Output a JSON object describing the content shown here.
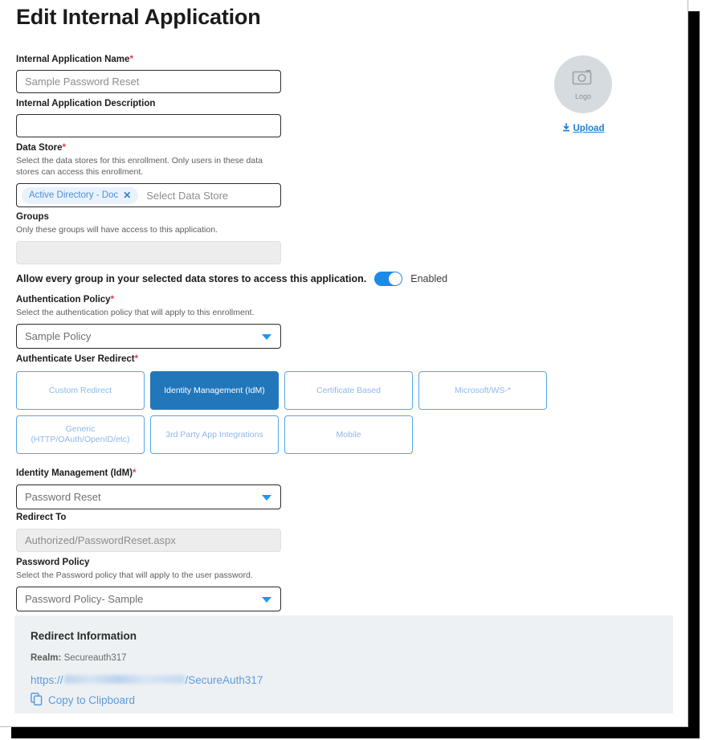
{
  "page": {
    "title": "Edit Internal Application"
  },
  "logo": {
    "placeholder_text": "Logo",
    "camera_icon": "camera-icon",
    "upload_label": "Upload",
    "upload_icon": "download-arrow-icon"
  },
  "fields": {
    "app_name": {
      "label": "Internal Application Name",
      "required_mark": "*",
      "value": "Sample Password Reset",
      "placeholder": "Sample Password Reset"
    },
    "app_description": {
      "label": "Internal Application Description",
      "value": "",
      "placeholder": ""
    },
    "data_store": {
      "label": "Data Store",
      "required_mark": "*",
      "helper": "Select the data stores for this enrollment. Only users in these data stores can access this enrollment.",
      "chips": [
        {
          "label": "Active Directory - Doc",
          "remove_icon": "✕"
        }
      ],
      "placeholder": "Select Data Store"
    },
    "groups": {
      "label": "Groups",
      "helper": "Only these groups will have access to this application.",
      "value": "",
      "disabled": true
    },
    "allow_all_groups": {
      "label": "Allow every group in your selected data stores to access this application.",
      "state_label": "Enabled",
      "enabled": true
    },
    "auth_policy": {
      "label": "Authentication Policy",
      "required_mark": "*",
      "helper": "Select the authentication policy that will apply to this enrollment.",
      "value": "Sample Policy"
    },
    "authenticate_user_redirect": {
      "label": "Authenticate User Redirect",
      "required_mark": "*",
      "options": [
        {
          "label": "Custom Redirect",
          "selected": false
        },
        {
          "label": "Identity Management (IdM)",
          "selected": true
        },
        {
          "label": "Certificate Based",
          "selected": false
        },
        {
          "label": "Microsoft/WS-*",
          "selected": false
        },
        {
          "label": "Generic (HTTP/OAuth/OpenID/etc)",
          "selected": false
        },
        {
          "label": "3rd Party App Integrations",
          "selected": false
        },
        {
          "label": "Mobile",
          "selected": false
        }
      ]
    },
    "idm": {
      "label": "Identity Management (IdM)",
      "required_mark": "*",
      "value": "Password Reset"
    },
    "redirect_to": {
      "label": "Redirect To",
      "value": "Authorized/PasswordReset.aspx",
      "disabled": true
    },
    "password_policy": {
      "label": "Password Policy",
      "helper": "Select the Password policy that will apply to the user password.",
      "value": "Password Policy- Sample"
    }
  },
  "redirect_information": {
    "title": "Redirect Information",
    "realm_label": "Realm:",
    "realm_value": "Secureauth317",
    "url_prefix": "https://",
    "url_redacted": "",
    "url_suffix": "/SecureAuth317",
    "copy_label": "Copy to Clipboard",
    "copy_icon": "copy-icon"
  },
  "colors": {
    "accent_blue": "#1e8ae8",
    "selected_tile": "#2277bb",
    "tile_border": "#58a6e8",
    "required_red": "#e8384f",
    "panel_bg": "#eef1f3"
  }
}
